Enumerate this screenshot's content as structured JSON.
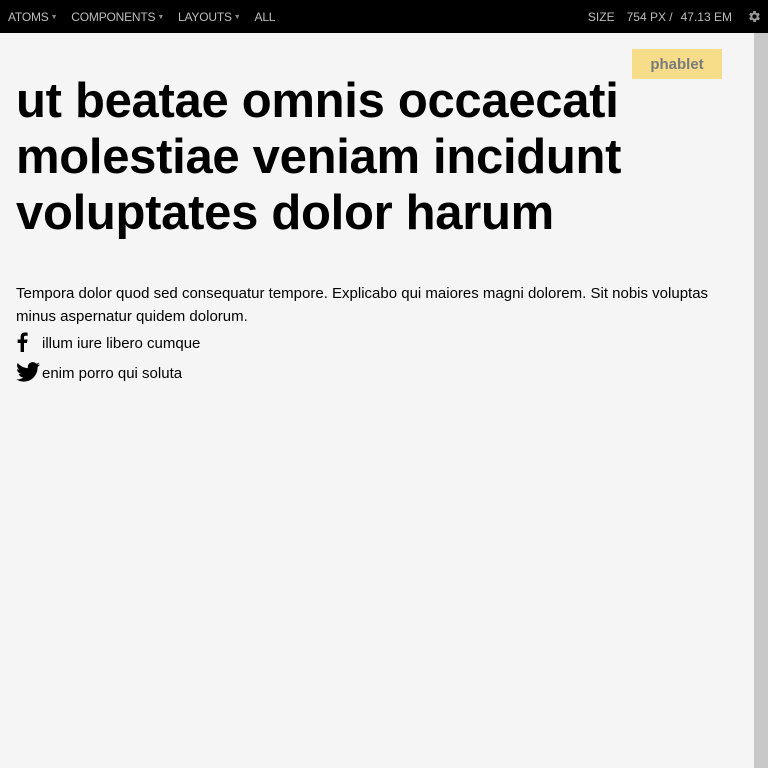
{
  "toolbar": {
    "nav": [
      {
        "label": "ATOMS",
        "dropdown": true
      },
      {
        "label": "COMPONENTS",
        "dropdown": true
      },
      {
        "label": "LAYOUTS",
        "dropdown": true
      },
      {
        "label": "ALL",
        "dropdown": false
      }
    ],
    "size_label": "SIZE",
    "size_px": "754 PX /",
    "size_em": "47.13 EM",
    "settings_icon": "gear-icon"
  },
  "badge": {
    "label": "phablet",
    "color": "#f7dc8a"
  },
  "article": {
    "headline": "ut beatae omnis occaecati molestiae veniam incidunt voluptates dolor harum",
    "body": "Tempora dolor quod sed consequatur tempore. Explicabo qui maiores magni dolorem. Sit nobis voluptas minus aspernatur quidem dolorum.",
    "share": [
      {
        "icon": "facebook-icon",
        "label": "illum iure libero cumque"
      },
      {
        "icon": "twitter-icon",
        "label": "enim porro qui soluta"
      }
    ]
  },
  "colors": {
    "toolbar_bg": "#000000",
    "page_bg": "#f5f5f5",
    "scrollbar": "#c8c8c8"
  }
}
